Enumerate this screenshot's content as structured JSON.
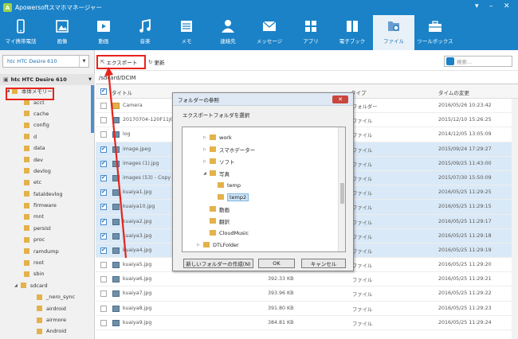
{
  "app": {
    "title": "Apowersoftスマホマネージャー"
  },
  "toolbar": {
    "items": [
      {
        "label": "マイ携帯電話",
        "icon": "phone-icon"
      },
      {
        "label": "画像",
        "icon": "image-icon"
      },
      {
        "label": "動画",
        "icon": "video-icon"
      },
      {
        "label": "音楽",
        "icon": "music-icon"
      },
      {
        "label": "メモ",
        "icon": "memo-icon"
      },
      {
        "label": "連絡先",
        "icon": "contact-icon"
      },
      {
        "label": "メッセージ",
        "icon": "message-icon"
      },
      {
        "label": "アプリ",
        "icon": "apps-icon"
      },
      {
        "label": "電子ブック",
        "icon": "ebook-icon"
      },
      {
        "label": "ファイル",
        "icon": "file-icon"
      },
      {
        "label": "ツールボックス",
        "icon": "toolbox-icon"
      }
    ]
  },
  "device": {
    "selector": "htc HTC Desire 610",
    "tree_root": "htc HTC Desire 610"
  },
  "tree": {
    "storage": "本体メモリー",
    "folders": [
      "acct",
      "cache",
      "config",
      "d",
      "data",
      "dev",
      "devlog",
      "etc",
      "fataldevlog",
      "firmware",
      "mnt",
      "persist",
      "proc",
      "ramdump",
      "root",
      "sbin",
      "sdcard"
    ],
    "subfolders": [
      "_nero_sync",
      "airdroid",
      "airmore",
      "Android"
    ]
  },
  "actions": {
    "export": "エクスポート",
    "refresh": "更新"
  },
  "search": {
    "placeholder": "検索..."
  },
  "path": "/sdcard/DCIM",
  "table": {
    "headers": {
      "name": "タイトル",
      "type": "タイプ",
      "time": "タイムの変更"
    },
    "rows": [
      {
        "name": "Camera",
        "size": "",
        "type": "フォルダー",
        "time": "2016/05/26 10:23:42",
        "checked": false,
        "selected": false
      },
      {
        "name": "20170704-120F11J04",
        "size": "",
        "type": "ファイル",
        "time": "2015/12/10 15:26:25",
        "checked": false,
        "selected": false
      },
      {
        "name": "log",
        "size": "",
        "type": "ファイル",
        "time": "2014/12/05 13:05:09",
        "checked": false,
        "selected": false
      },
      {
        "name": "image.jpeg",
        "size": "",
        "type": "ファイル",
        "time": "2015/09/24 17:29:27",
        "checked": true,
        "selected": true
      },
      {
        "name": "images (1).jpg",
        "size": "",
        "type": "ファイル",
        "time": "2015/09/25 11:43:00",
        "checked": true,
        "selected": true
      },
      {
        "name": "images (53) - Copy",
        "size": "",
        "type": "ファイル",
        "time": "2015/07/30 15:50:09",
        "checked": true,
        "selected": true
      },
      {
        "name": "kuaiya1.jpg",
        "size": "",
        "type": "ファイル",
        "time": "2016/05/25 11:29:25",
        "checked": true,
        "selected": true
      },
      {
        "name": "kuaiya10.jpg",
        "size": "",
        "type": "ファイル",
        "time": "2016/05/25 11:29:15",
        "checked": true,
        "selected": true
      },
      {
        "name": "kuaiya2.jpg",
        "size": "",
        "type": "ファイル",
        "time": "2016/05/25 11:29:17",
        "checked": true,
        "selected": true
      },
      {
        "name": "kuaiya3.jpg",
        "size": "",
        "type": "ファイル",
        "time": "2016/05/25 11:29:18",
        "checked": true,
        "selected": true
      },
      {
        "name": "kuaiya4.jpg",
        "size": "",
        "type": "ファイル",
        "time": "2016/05/25 11:29:19",
        "checked": true,
        "selected": true
      },
      {
        "name": "kuaiya5.jpg",
        "size": "",
        "type": "ファイル",
        "time": "2016/05/25 11:29:20",
        "checked": false,
        "selected": false
      },
      {
        "name": "kuaiya6.jpg",
        "size": "392.33 KB",
        "type": "ファイル",
        "time": "2016/05/25 11:29:21",
        "checked": false,
        "selected": false
      },
      {
        "name": "kuaiya7.jpg",
        "size": "393.96 KB",
        "type": "ファイル",
        "time": "2016/05/25 11:29:22",
        "checked": false,
        "selected": false
      },
      {
        "name": "kuaiya8.jpg",
        "size": "391.80 KB",
        "type": "ファイル",
        "time": "2016/05/25 11:29:23",
        "checked": false,
        "selected": false
      },
      {
        "name": "kuaiya9.jpg",
        "size": "384.81 KB",
        "type": "ファイル",
        "time": "2016/05/25 11:29:24",
        "checked": false,
        "selected": false
      }
    ]
  },
  "dialog": {
    "title": "フォルダーの参照",
    "message": "エクスポートフォルダを選択",
    "tree": [
      "work",
      "スマホデーター",
      "ソフト",
      "写真",
      "temp",
      "temp2",
      "動画",
      "翻訳",
      "CloudMusic",
      "DTLFolder"
    ],
    "buttons": {
      "new_folder": "新しいフォルダーの作成(N)",
      "ok": "OK",
      "cancel": "キャンセル"
    }
  },
  "colors": {
    "brand": "#1b82c7",
    "highlight": "#e8231b",
    "selection": "#d9e9f7"
  }
}
